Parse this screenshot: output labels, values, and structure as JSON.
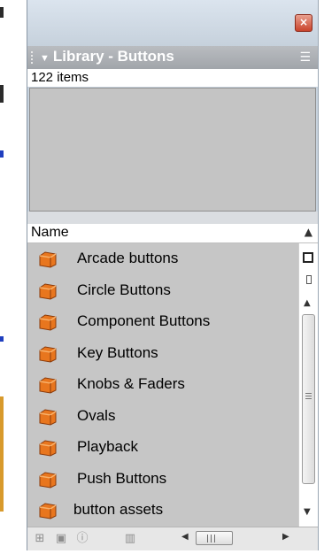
{
  "window": {
    "close_glyph": "×",
    "title": "Library - Buttons",
    "title_arrow": "▼",
    "menu_glyph": "☰"
  },
  "library": {
    "item_count": "122 items",
    "column_header": "Name",
    "sort_glyph": "▲",
    "items": [
      {
        "label": "Arcade buttons",
        "icon": "folder-icon"
      },
      {
        "label": "Circle Buttons",
        "icon": "folder-icon"
      },
      {
        "label": "Component Buttons",
        "icon": "folder-icon"
      },
      {
        "label": "Key Buttons",
        "icon": "folder-icon"
      },
      {
        "label": "Knobs & Faders",
        "icon": "folder-icon"
      },
      {
        "label": "Ovals",
        "icon": "folder-icon"
      },
      {
        "label": "Playback",
        "icon": "folder-icon"
      },
      {
        "label": "Push Buttons",
        "icon": "folder-icon"
      },
      {
        "label": "button assets",
        "icon": "folder-icon"
      }
    ]
  },
  "bottom_toolbar": {
    "icons": [
      "new-symbol-icon",
      "new-folder-icon",
      "properties-icon",
      "delete-icon"
    ]
  },
  "colors": {
    "panel_bg": "#c8d3de",
    "title_bg": "#a1a5aa",
    "list_bg": "#c6c6c6",
    "close_button": "#c9432b",
    "folder_orange": "#e8761e"
  }
}
